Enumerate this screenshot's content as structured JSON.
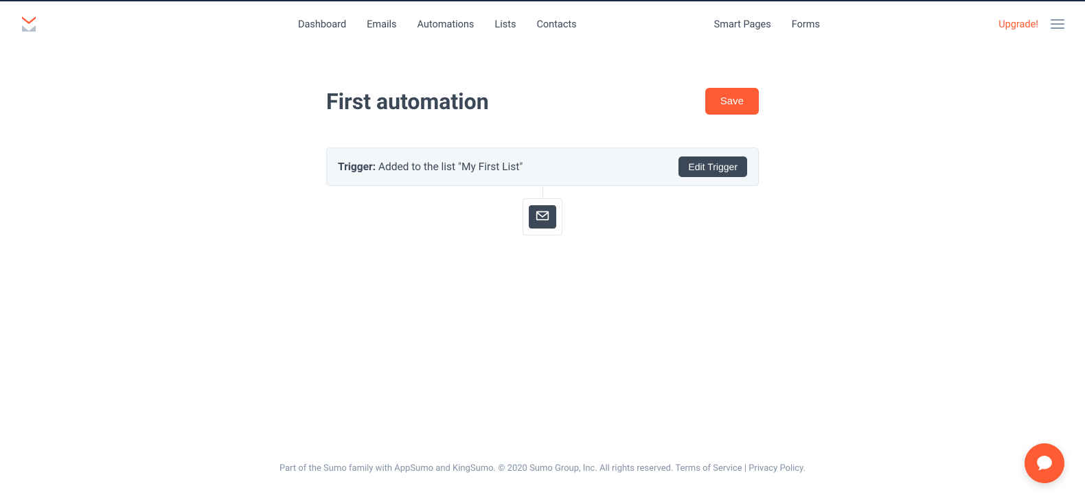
{
  "nav": {
    "primary": [
      "Dashboard",
      "Emails",
      "Automations",
      "Lists",
      "Contacts"
    ],
    "secondary": [
      "Smart Pages",
      "Forms"
    ],
    "upgrade_label": "Upgrade!"
  },
  "page": {
    "title": "First automation",
    "save_label": "Save"
  },
  "trigger": {
    "label": "Trigger:",
    "description": " Added to the list \"My First List\"",
    "edit_label": "Edit Trigger"
  },
  "footer": {
    "text_prefix": "Part of the Sumo family with AppSumo and KingSumo. © 2020 Sumo Group, Inc. All rights reserved. ",
    "terms_label": "Terms of Service",
    "sep": " | ",
    "privacy_label": "Privacy Policy",
    "suffix": "."
  }
}
